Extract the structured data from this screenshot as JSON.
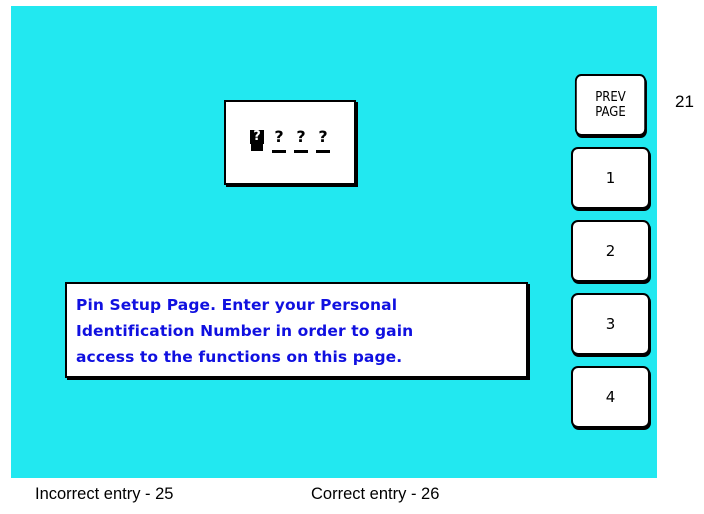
{
  "pin_entry": {
    "digits": [
      "?",
      "?",
      "?",
      "?"
    ],
    "active_index": 0
  },
  "message": {
    "lines": [
      "Pin Setup Page. Enter your Personal",
      "Identification Number in order to gain",
      "access to the functions on this page."
    ]
  },
  "side_buttons": {
    "prev_page": [
      "PREV",
      "PAGE"
    ],
    "button_1": "1",
    "button_2": "2",
    "button_3": "3",
    "button_4": "4"
  },
  "page_number": "21",
  "footer": {
    "incorrect": "Incorrect entry - 25",
    "correct": "Correct entry - 26"
  },
  "colors": {
    "screen_background": "#22e8f0",
    "message_text": "#1010e0"
  }
}
